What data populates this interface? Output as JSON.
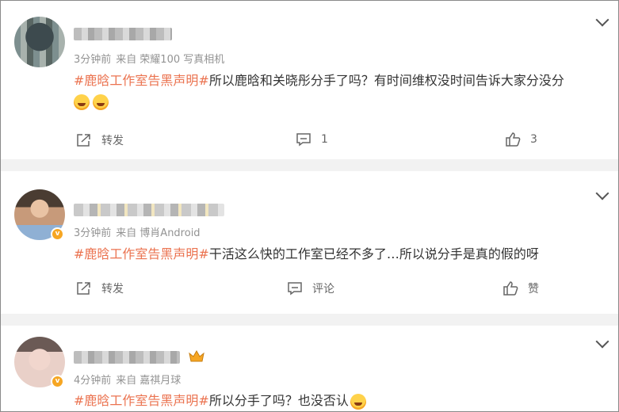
{
  "posts": [
    {
      "time": "3分钟前",
      "from_prefix": "来自",
      "source": "荣耀100 写真相机",
      "hashtag": "#鹿晗工作室告黑声明#",
      "text": "所以鹿晗和关晓彤分手了吗？有时间维权没时间告诉大家分没分",
      "emoji": [
        "laughing-tears",
        "laughing-tears"
      ],
      "actions": {
        "repost": "转发",
        "comment": "1",
        "like": "3"
      }
    },
    {
      "time": "3分钟前",
      "from_prefix": "来自",
      "source": "博肖Android",
      "hashtag": "#鹿晗工作室告黑声明#",
      "text": "干活这么快的工作室已经不多了…所以说分手是真的假的呀",
      "actions": {
        "repost": "转发",
        "comment": "评论",
        "like": "赞"
      }
    },
    {
      "time": "4分钟前",
      "from_prefix": "来自",
      "source": "嘉祺月球",
      "hashtag": "#鹿晗工作室告黑声明#",
      "text": "所以分手了吗？也没否认",
      "emoji": [
        "pleading-face"
      ]
    }
  ],
  "colors": {
    "hashtag": "#eb7350",
    "meta": "#939393",
    "separator": "#f2f2f2",
    "verified": "#f6a623"
  }
}
